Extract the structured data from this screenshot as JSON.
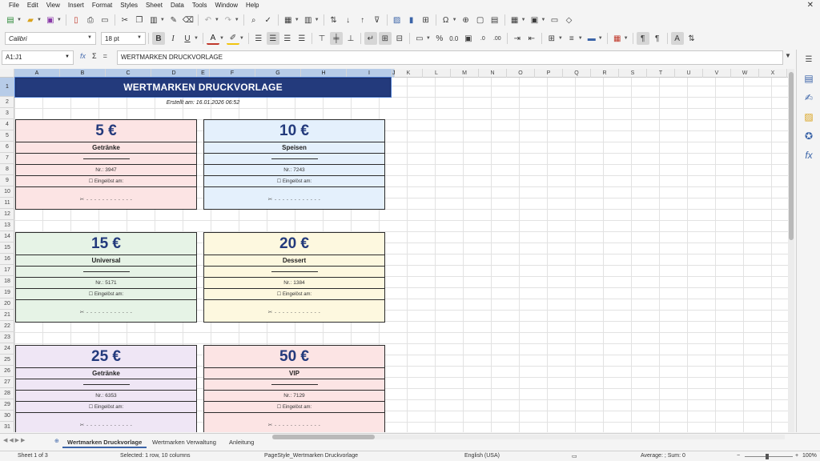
{
  "menu": [
    "File",
    "Edit",
    "View",
    "Insert",
    "Format",
    "Styles",
    "Sheet",
    "Data",
    "Tools",
    "Window",
    "Help"
  ],
  "font": {
    "name": "Calibri",
    "size": "18 pt"
  },
  "formula": {
    "cell_ref": "A1:J1",
    "content": "WERTMARKEN DRUCKVORLAGE"
  },
  "columns": [
    "A",
    "B",
    "C",
    "D",
    "E",
    "F",
    "G",
    "H",
    "I",
    "J",
    "K",
    "L",
    "M",
    "N",
    "O",
    "P",
    "Q",
    "R",
    "S",
    "T",
    "U",
    "V",
    "W",
    "X"
  ],
  "rows": [
    "1",
    "2",
    "3",
    "4",
    "5",
    "6",
    "7",
    "8",
    "9",
    "10",
    "11",
    "12",
    "13",
    "14",
    "15",
    "16",
    "17",
    "18",
    "19",
    "20",
    "21",
    "22",
    "23",
    "24",
    "25",
    "26",
    "27",
    "28",
    "29",
    "30",
    "31"
  ],
  "sheet": {
    "title": "WERTMARKEN DRUCKVORLAGE",
    "created": "Erstellt am: 16.01.2026 06:52",
    "vouchers": [
      {
        "amount": "5 €",
        "category": "Getränke",
        "nr": "Nr.: 3947",
        "redeemed": "☐ Eingelöst am:",
        "cut": "✂ - - - - - - - - - - - -",
        "bg": "#fce4e4"
      },
      {
        "amount": "10 €",
        "category": "Speisen",
        "nr": "Nr.: 7243",
        "redeemed": "☐ Eingelöst am:",
        "cut": "✂ - - - - - - - - - - - -",
        "bg": "#e4f0fc"
      },
      {
        "amount": "15 €",
        "category": "Universal",
        "nr": "Nr.: 5171",
        "redeemed": "☐ Eingelöst am:",
        "cut": "✂ - - - - - - - - - - - -",
        "bg": "#e6f3e6"
      },
      {
        "amount": "20 €",
        "category": "Dessert",
        "nr": "Nr.: 1384",
        "redeemed": "☐ Eingelöst am:",
        "cut": "✂ - - - - - - - - - - - -",
        "bg": "#fdf8df"
      },
      {
        "amount": "25 €",
        "category": "Getränke",
        "nr": "Nr.: 6353",
        "redeemed": "☐ Eingelöst am:",
        "cut": "✂ - - - - - - - - - - - -",
        "bg": "#efe6f5"
      },
      {
        "amount": "50 €",
        "category": "VIP",
        "nr": "Nr.: 7129",
        "redeemed": "☐ Eingelöst am:",
        "cut": "✂ - - - - - - - - - - - -",
        "bg": "#fce4e4"
      }
    ]
  },
  "tabs": [
    "Wertmarken Druckvorlage",
    "Wertmarken Verwaltung",
    "Anleitung"
  ],
  "status": {
    "sheet": "Sheet 1 of 3",
    "selection": "Selected: 1 row, 10 columns",
    "pagestyle": "PageStyle_Wertmarken Druckvorlage",
    "language": "English (USA)",
    "sum": "Average: ; Sum: 0",
    "zoom": "100%"
  }
}
